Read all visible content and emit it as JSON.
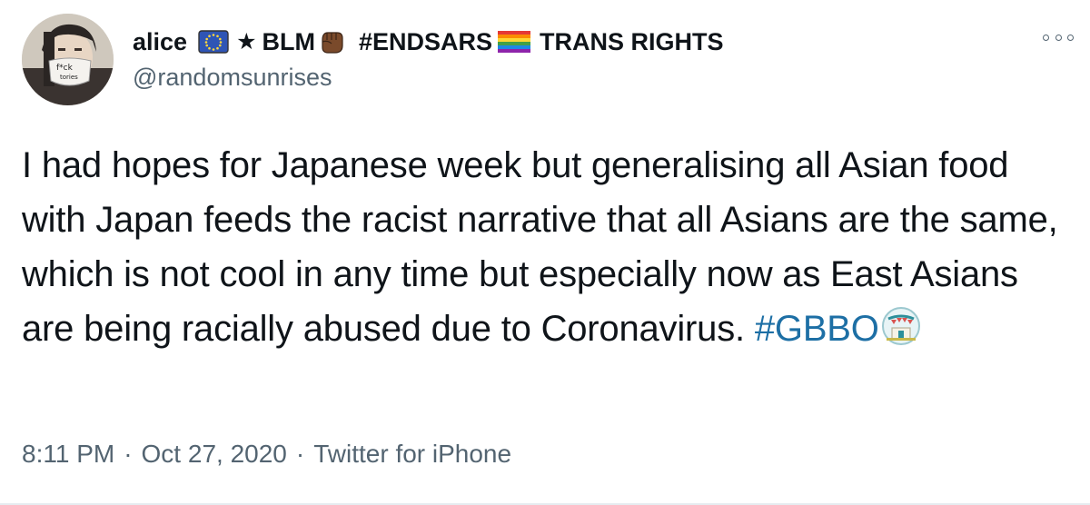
{
  "tweet": {
    "display_name": "alice",
    "name_parts": [
      "BLM",
      "#ENDSARS",
      "TRANS RIGHTS"
    ],
    "handle": "@randomsunrises",
    "text_main": "I had hopes for Japanese week but generalising all Asian food with Japan feeds the racist narrative that all Asians are the same, which is not cool in any time but especially now as East Asians are being racially abused due to Coronavirus.",
    "hashtag": "#GBBO",
    "time": "8:11 PM",
    "date": "Oct 27, 2020",
    "source": "Twitter for iPhone",
    "separator": "·",
    "star_glyph": "★"
  },
  "icons": {
    "avatar": "profile-photo",
    "flag": "eu-flag-icon",
    "fist": "raised-fist-icon",
    "rainbow": "rainbow-flag-icon",
    "hashtag_emoji": "tent-icon",
    "more": "more-options-icon"
  },
  "colors": {
    "text": "#0f1419",
    "secondary": "#536471",
    "link": "#1d6fa5"
  }
}
